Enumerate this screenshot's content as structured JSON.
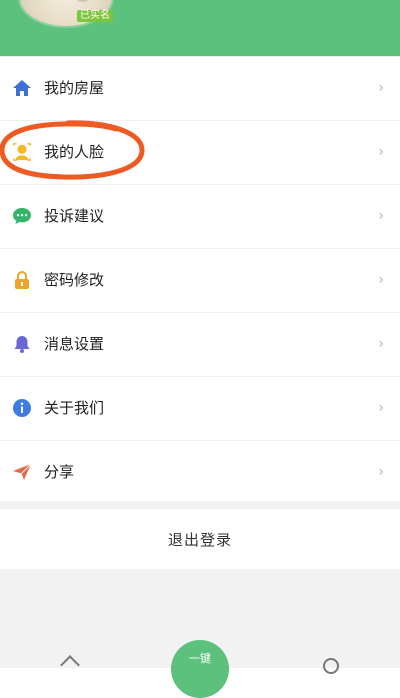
{
  "header": {
    "badge": "已实名",
    "accent_color": "#5cc17c"
  },
  "menu": {
    "items": [
      {
        "label": "我的房屋",
        "icon": "home-icon",
        "icon_color": "#3d6fd6"
      },
      {
        "label": "我的人脸",
        "icon": "face-icon",
        "icon_color": "#f3b72a"
      },
      {
        "label": "投诉建议",
        "icon": "chat-bubble-icon",
        "icon_color": "#35b36a"
      },
      {
        "label": "密码修改",
        "icon": "lock-icon",
        "icon_color": "#f0a32b"
      },
      {
        "label": "消息设置",
        "icon": "bell-icon",
        "icon_color": "#6a67d6"
      },
      {
        "label": "关于我们",
        "icon": "info-icon",
        "icon_color": "#3d7be6"
      },
      {
        "label": "分享",
        "icon": "paper-plane-icon",
        "icon_color": "#e56a4b"
      }
    ],
    "chevron": "›"
  },
  "logout": {
    "label": "退出登录"
  },
  "bottom_bar": {
    "center_label": "一键"
  },
  "annotation": {
    "color": "#ee5a21",
    "target": "我的人脸"
  }
}
